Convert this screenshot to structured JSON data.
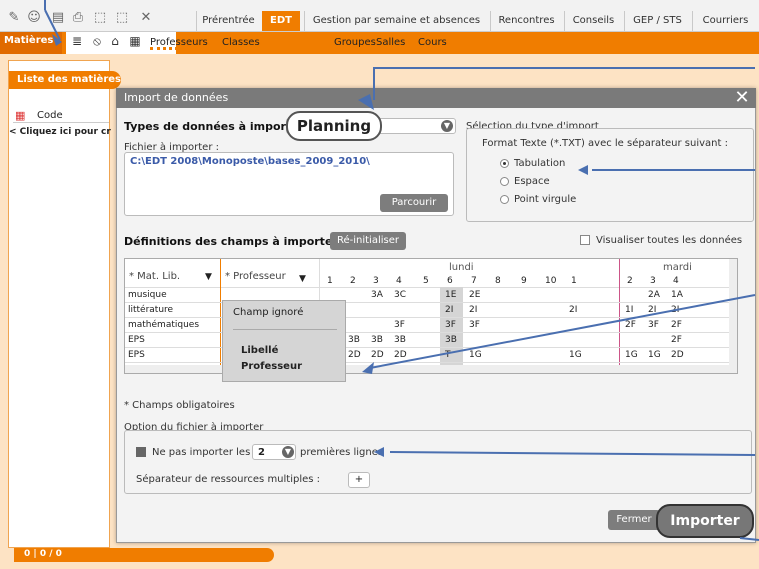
{
  "toolbar": {
    "tabs": [
      "Prérentrée",
      "EDT",
      "Gestion par semaine et absences",
      "Rencontres",
      "Conseils",
      "GEP / STS",
      "Courriers"
    ],
    "active_tab": "EDT"
  },
  "subnav": {
    "section": "Matières",
    "links": [
      "Professeurs",
      "Classes",
      "Groupes",
      "Salles",
      "Cours"
    ]
  },
  "left_panel": {
    "title": "Liste des matières",
    "column": "Code",
    "add_row": "< Cliquez ici pour cr",
    "status": "0  |  0 / 0"
  },
  "dialog": {
    "title": "Import de données",
    "type_label": "Types de données à import",
    "type_value": "Planning",
    "file_label": "Fichier à importer :",
    "file_path": "C:\\EDT 2008\\Monoposte\\bases_2009_2010\\",
    "browse_button": "Parcourir",
    "separator_section": "Sélection du type d'import",
    "format_label": "Format Texte (*.TXT) avec le séparateur suivant :",
    "separators": [
      "Tabulation",
      "Espace",
      "Point virgule"
    ],
    "selected_separator": "Tabulation",
    "fields_label": "Définitions des champs à importer :",
    "reset_button": "Ré-initialiser",
    "show_all_label": "Visualiser toutes les données",
    "required_note": "* Champs obligatoires",
    "options_section": "Option du fichier à importer",
    "skip_lines_label": "Ne pas importer les",
    "skip_lines_value": "2",
    "skip_lines_suffix": "premières lignes",
    "multi_sep_label": "Séparateur de ressources multiples :",
    "multi_sep_value": "+",
    "close_button": "Fermer",
    "import_button": "Importer"
  },
  "grid": {
    "col1": "* Mat. Lib.",
    "col2": "* Professeur",
    "days": [
      "lundi",
      "mardi"
    ],
    "hours_lundi": [
      "1",
      "2",
      "3",
      "4",
      "5",
      "6",
      "7",
      "8",
      "9",
      "10"
    ],
    "hours_mardi": [
      "1",
      "2",
      "3",
      "4"
    ],
    "rows": [
      {
        "lib": "musique",
        "cells": [
          "",
          "",
          "3A",
          "3C",
          "",
          "1E",
          "2E",
          "",
          "",
          "",
          "",
          "",
          "2A",
          "1A"
        ]
      },
      {
        "lib": "littérature",
        "cells": [
          "",
          "",
          "",
          "",
          "",
          "2I",
          "2I",
          "",
          "",
          "",
          "2I",
          "1I",
          "2I",
          "2I"
        ]
      },
      {
        "lib": "mathématiques",
        "cells": [
          "",
          "",
          "",
          "3F",
          "",
          "3F",
          "3F",
          "",
          "",
          "",
          "",
          "2F",
          "3F",
          "2F"
        ]
      },
      {
        "lib": "EPS",
        "cells": [
          "",
          "3B",
          "3B",
          "3B",
          "",
          "3B",
          "",
          "",
          "",
          "",
          "",
          "",
          "",
          "2F"
        ]
      },
      {
        "lib": "EPS",
        "cells": [
          "",
          "2D",
          "2D",
          "2D",
          "",
          "T",
          "1G",
          "",
          "",
          "",
          "1G",
          "1G",
          "1G",
          "2D"
        ]
      }
    ]
  },
  "popup": {
    "items": [
      "Champ ignoré",
      "Libellé",
      "Professeur"
    ]
  }
}
